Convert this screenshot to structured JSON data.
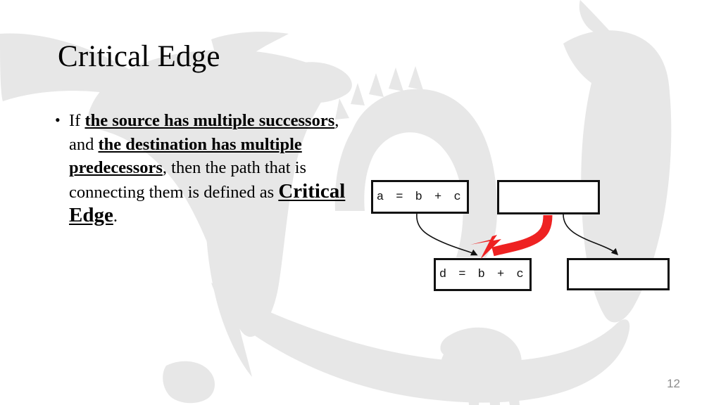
{
  "slide": {
    "title": "Critical Edge",
    "page_number": "12",
    "colors": {
      "critical_edge_arrow": "#ee2222",
      "node_border": "#111111",
      "watermark": "#e7e7e7",
      "page_number": "#8c8c8c"
    }
  },
  "body": {
    "bullet_marker": "•",
    "segments": {
      "lead_in": "If ",
      "term_source": "the source has multiple successors",
      "conjunction": ", and ",
      "term_destination": "the destination has multiple predecessors",
      "middle": ", then the path that is connecting them is defined as ",
      "term_critical_edge": "Critical Edge",
      "period": "."
    },
    "full_text": "If the source has multiple successors, and the destination has multiple predecessors, then the path that is connecting them is defined as Critical Edge."
  },
  "diagram": {
    "nodes": [
      {
        "id": "node-a",
        "label": "a = b + c",
        "position": "top-left",
        "empty": false
      },
      {
        "id": "node-b",
        "label": "",
        "position": "top-right",
        "empty": true
      },
      {
        "id": "node-d",
        "label": "d = b + c",
        "position": "bottom-left",
        "empty": false
      },
      {
        "id": "node-e",
        "label": "",
        "position": "bottom-right",
        "empty": true
      }
    ],
    "edges": [
      {
        "from": "node-a",
        "to": "node-d",
        "style": "thin-black-curve",
        "highlight": false
      },
      {
        "from": "node-b",
        "to": "node-d",
        "style": "thick-red-curve",
        "highlight": true,
        "meaning": "critical-edge"
      },
      {
        "from": "node-b",
        "to": "node-e",
        "style": "thin-black-curve",
        "highlight": false
      }
    ]
  }
}
